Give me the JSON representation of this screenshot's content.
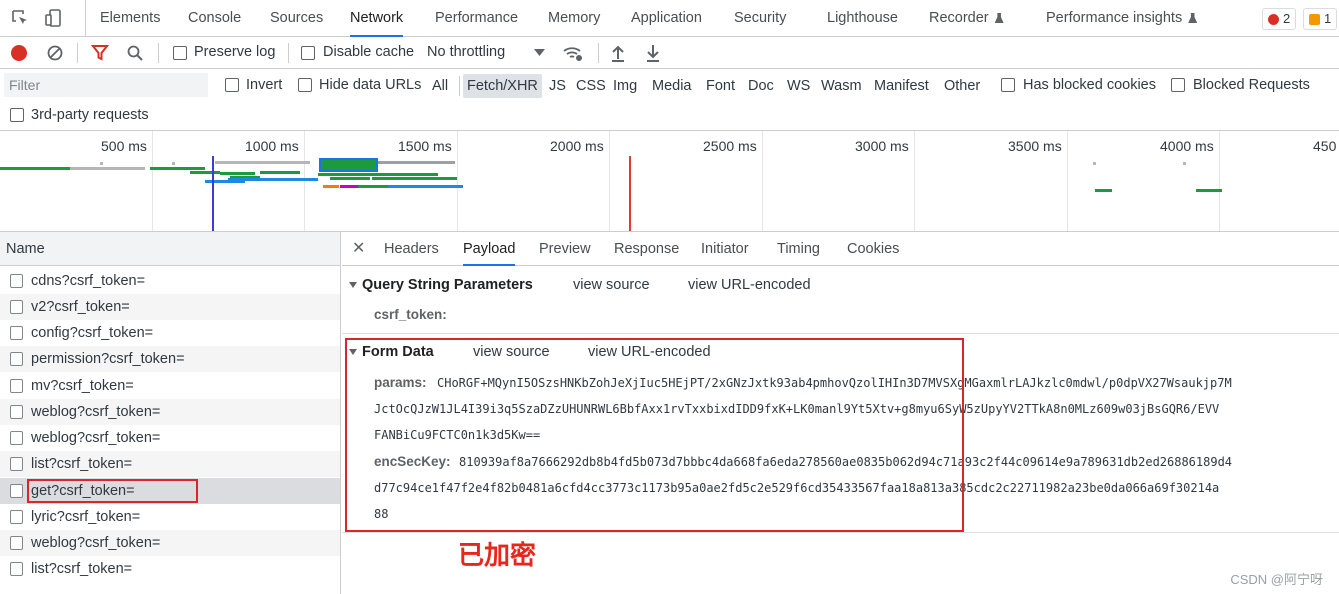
{
  "top_tabs": [
    "Elements",
    "Console",
    "Sources",
    "Network",
    "Performance",
    "Memory",
    "Application",
    "Security",
    "Lighthouse",
    "Recorder",
    "Performance insights"
  ],
  "active_tab": "Network",
  "badges": {
    "errors": "2",
    "warnings": "1",
    "error_color": "#d93025",
    "warning_color": "#f29900"
  },
  "toolbar": {
    "preserve_log": "Preserve log",
    "disable_cache": "Disable cache",
    "throttling": "No throttling"
  },
  "filter": {
    "placeholder": "Filter",
    "invert": "Invert",
    "hide_data_urls": "Hide data URLs",
    "types": [
      "All",
      "Fetch/XHR",
      "JS",
      "CSS",
      "Img",
      "Media",
      "Font",
      "Doc",
      "WS",
      "Wasm",
      "Manifest",
      "Other"
    ],
    "selected_type": "Fetch/XHR",
    "has_blocked_cookies": "Has blocked cookies",
    "blocked_requests": "Blocked Requests",
    "third_party": "3rd-party requests"
  },
  "overview": {
    "ticks": [
      "500 ms",
      "1000 ms",
      "1500 ms",
      "2000 ms",
      "2500 ms",
      "3000 ms",
      "3500 ms",
      "4000 ms",
      "450"
    ]
  },
  "request_list": {
    "header": "Name",
    "items": [
      "cdns?csrf_token=",
      "v2?csrf_token=",
      "config?csrf_token=",
      "permission?csrf_token=",
      "mv?csrf_token=",
      "weblog?csrf_token=",
      "weblog?csrf_token=",
      "list?csrf_token=",
      "get?csrf_token=",
      "lyric?csrf_token=",
      "weblog?csrf_token=",
      "list?csrf_token="
    ],
    "selected_index": 8
  },
  "detail_tabs": [
    "Headers",
    "Payload",
    "Preview",
    "Response",
    "Initiator",
    "Timing",
    "Cookies"
  ],
  "active_detail_tab": "Payload",
  "payload": {
    "query_section": {
      "title": "Query String Parameters",
      "view_source": "view source",
      "view_url_encoded": "view URL-encoded",
      "params": [
        {
          "key": "csrf_token:",
          "value": ""
        }
      ]
    },
    "form_section": {
      "title": "Form Data",
      "view_source": "view source",
      "view_url_encoded": "view URL-encoded",
      "params_key": "params:",
      "params_lines": [
        "CHoRGF+MQynI5OSzsHNKbZohJeXjIuc5HEjPT/2xGNzJxtk93ab4pmhovQzolIHIn3D7MVSXgMGaxmlrLAJkzlc0mdwl/p0dpVX27Wsaukjp7M",
        "JctOcQJzW1JL4I39i3q5SzaDZzUHUNRWL6BbfAxx1rvTxxbixdIDD9fxK+LK0manl9Yt5Xtv+g8myu6SyW5zUpyYV2TTkA8n0MLz609w03jBsGQR6/EVV",
        "FANBiCu9FCTC0n1k3d5Kw=="
      ],
      "enc_key": "encSecKey:",
      "enc_lines": [
        "810939af8a7666292db8b4fd5b073d7bbbc4da668fa6eda278560ae0835b062d94c71a93c2f44c09614e9a789631db2ed26886189d4",
        "d77c94ce1f47f2e4f82b0481a6cfd4cc3773c1173b95a0ae2fd5c2e529f6cd35433567faa18a813a385cdc2c22711982a23be0da066a69f30214a",
        "88"
      ]
    }
  },
  "annotation": "已加密",
  "watermark": "CSDN @阿宁呀",
  "colors": {
    "accent": "#1a73e8",
    "highlight_red": "#d9262d",
    "record_red": "#d93025"
  }
}
